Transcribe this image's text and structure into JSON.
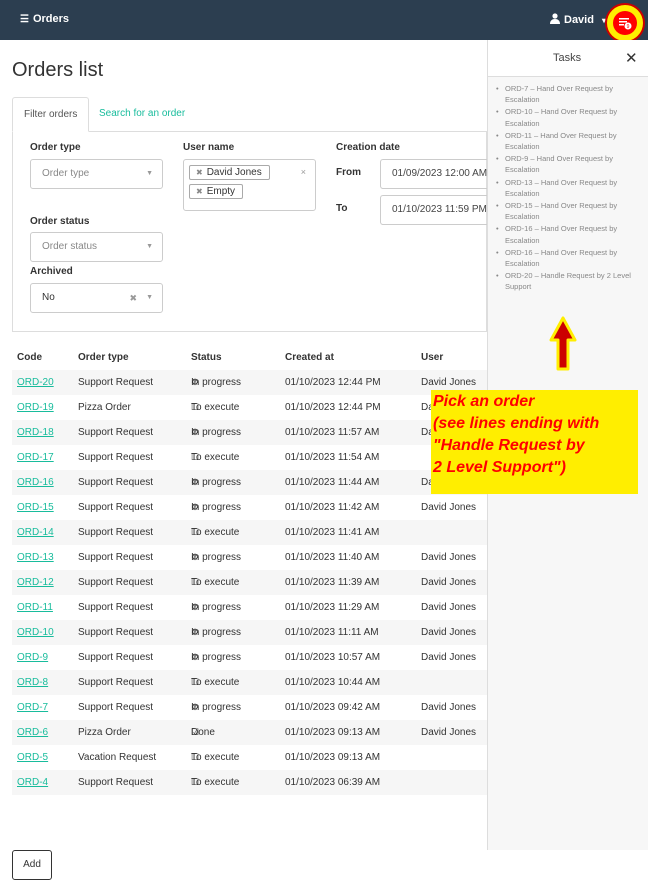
{
  "topbar": {
    "brand_label": "Orders",
    "user_name": "David",
    "task_count": "9"
  },
  "page": {
    "title": "Orders list"
  },
  "tabs": [
    {
      "label": "Filter orders"
    },
    {
      "label": "Search for an order"
    }
  ],
  "filters": {
    "order_type": {
      "label": "Order type",
      "placeholder": "Order type"
    },
    "user_name": {
      "label": "User name",
      "chips": [
        "David Jones",
        "Empty"
      ]
    },
    "creation_date": {
      "label": "Creation date",
      "from_label": "From",
      "from_value": "01/09/2023 12:00 AM",
      "to_label": "To",
      "to_value": "01/10/2023 11:59 PM"
    },
    "order_status": {
      "label": "Order status",
      "placeholder": "Order status"
    },
    "archived": {
      "label": "Archived",
      "value": "No"
    }
  },
  "table": {
    "columns": [
      "Code",
      "Order type",
      "Status",
      "Created at",
      "User"
    ],
    "rows": [
      {
        "code": "ORD-20",
        "type": "Support Request",
        "status": "In progress",
        "created": "01/10/2023 12:44 PM",
        "user": "David Jones"
      },
      {
        "code": "ORD-19",
        "type": "Pizza Order",
        "status": "To execute",
        "created": "01/10/2023 12:44 PM",
        "user": "Da"
      },
      {
        "code": "ORD-18",
        "type": "Support Request",
        "status": "In progress",
        "created": "01/10/2023 11:57 AM",
        "user": "Da"
      },
      {
        "code": "ORD-17",
        "type": "Support Request",
        "status": "To execute",
        "created": "01/10/2023 11:54 AM",
        "user": ""
      },
      {
        "code": "ORD-16",
        "type": "Support Request",
        "status": "In progress",
        "created": "01/10/2023 11:44 AM",
        "user": "Da"
      },
      {
        "code": "ORD-15",
        "type": "Support Request",
        "status": "In progress",
        "created": "01/10/2023 11:42 AM",
        "user": "David Jones"
      },
      {
        "code": "ORD-14",
        "type": "Support Request",
        "status": "To execute",
        "created": "01/10/2023 11:41 AM",
        "user": ""
      },
      {
        "code": "ORD-13",
        "type": "Support Request",
        "status": "In progress",
        "created": "01/10/2023 11:40 AM",
        "user": "David Jones"
      },
      {
        "code": "ORD-12",
        "type": "Support Request",
        "status": "To execute",
        "created": "01/10/2023 11:39 AM",
        "user": "David Jones"
      },
      {
        "code": "ORD-11",
        "type": "Support Request",
        "status": "In progress",
        "created": "01/10/2023 11:29 AM",
        "user": "David Jones"
      },
      {
        "code": "ORD-10",
        "type": "Support Request",
        "status": "In progress",
        "created": "01/10/2023 11:11 AM",
        "user": "David Jones"
      },
      {
        "code": "ORD-9",
        "type": "Support Request",
        "status": "In progress",
        "created": "01/10/2023 10:57 AM",
        "user": "David Jones"
      },
      {
        "code": "ORD-8",
        "type": "Support Request",
        "status": "To execute",
        "created": "01/10/2023 10:44 AM",
        "user": ""
      },
      {
        "code": "ORD-7",
        "type": "Support Request",
        "status": "In progress",
        "created": "01/10/2023 09:42 AM",
        "user": "David Jones"
      },
      {
        "code": "ORD-6",
        "type": "Pizza Order",
        "status": "Done",
        "created": "01/10/2023 09:13 AM",
        "user": "David Jones"
      },
      {
        "code": "ORD-5",
        "type": "Vacation Request",
        "status": "To execute",
        "created": "01/10/2023 09:13 AM",
        "user": ""
      },
      {
        "code": "ORD-4",
        "type": "Support Request",
        "status": "To execute",
        "created": "01/10/2023 06:39 AM",
        "user": ""
      }
    ]
  },
  "add_label": "Add",
  "sidebar": {
    "title": "Tasks",
    "tasks": [
      "ORD-7 – Hand Over Request by Escalation",
      "ORD-10 – Hand Over Request by Escalation",
      "ORD-11 – Hand Over Request by Escalation",
      "ORD-9 – Hand Over Request by Escalation",
      "ORD-13 – Hand Over Request by Escalation",
      "ORD-15 – Hand Over Request by Escalation",
      "ORD-16 – Hand Over Request by Escalation",
      "ORD-16 – Hand Over Request by Escalation",
      "ORD-20 – Handle Request by 2 Level Support"
    ]
  },
  "annotation": {
    "lines": [
      "Pick an order",
      "(see lines ending with",
      "\"Handle Request by",
      "2 Level Support\")"
    ],
    "highlight_color": "#ffee00",
    "text_color": "#ff0000"
  },
  "colors": {
    "topbar": "#2c3e50",
    "link": "#18bc9c"
  },
  "icons": {
    "in_progress": "gears-icon",
    "to_execute": "square-icon",
    "done": "check-square-icon"
  }
}
